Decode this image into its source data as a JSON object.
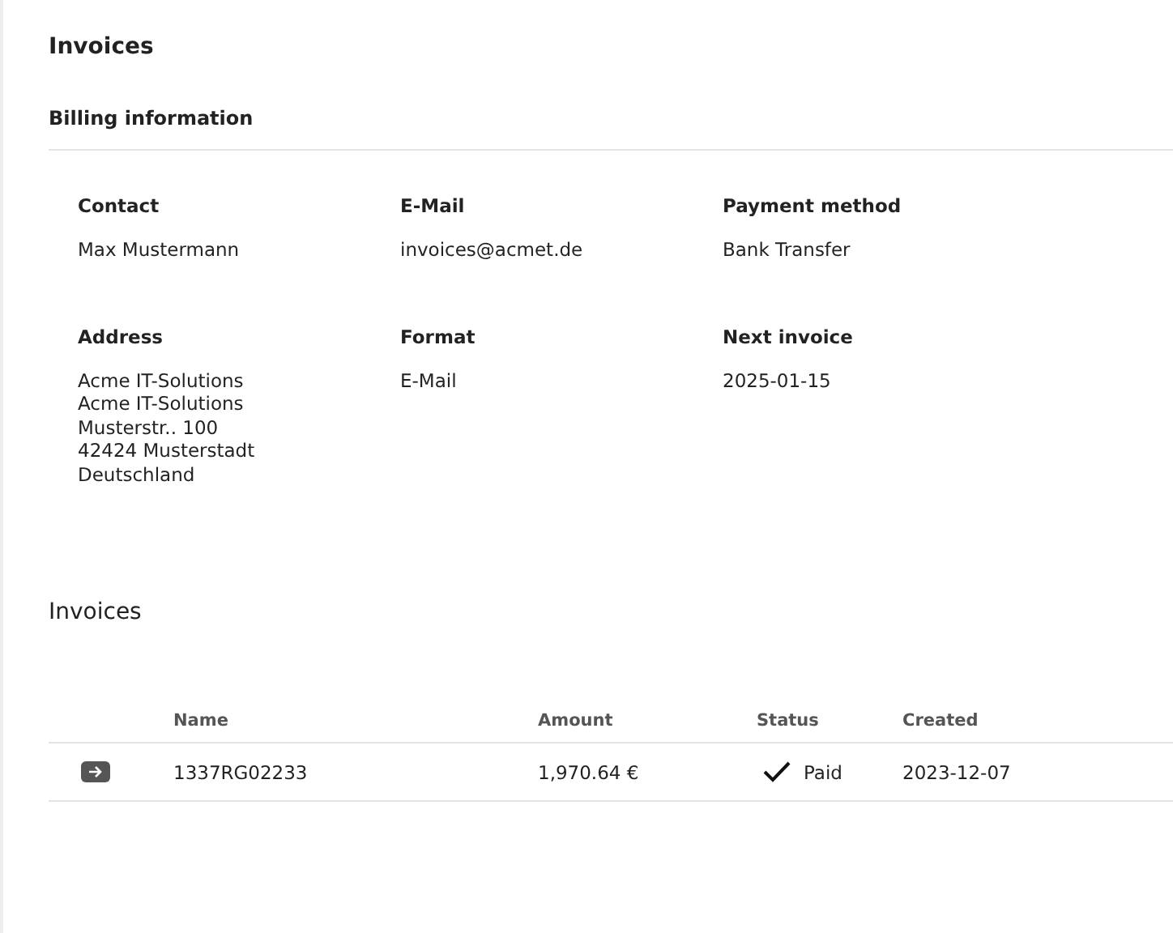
{
  "page": {
    "title": "Invoices"
  },
  "billing": {
    "title": "Billing information",
    "fields": [
      {
        "label": "Contact",
        "lines": [
          "Max Mustermann"
        ]
      },
      {
        "label": "E-Mail",
        "lines": [
          "invoices@acmet.de"
        ]
      },
      {
        "label": "Payment method",
        "lines": [
          "Bank Transfer"
        ]
      },
      {
        "label": "Address",
        "lines": [
          "Acme IT-Solutions",
          "Acme IT-Solutions",
          "Musterstr.. 100",
          "42424 Musterstadt",
          "Deutschland"
        ]
      },
      {
        "label": "Format",
        "lines": [
          "E-Mail"
        ]
      },
      {
        "label": "Next invoice",
        "lines": [
          "2025-01-15"
        ]
      }
    ]
  },
  "invoices": {
    "title": "Invoices",
    "columns": [
      "Name",
      "Amount",
      "Status",
      "Created"
    ],
    "rows": [
      {
        "name": "1337RG02233",
        "amount": "1,970.64 €",
        "status": {
          "kind": "paid",
          "label": "Paid"
        },
        "created": "2023-12-07"
      }
    ]
  }
}
